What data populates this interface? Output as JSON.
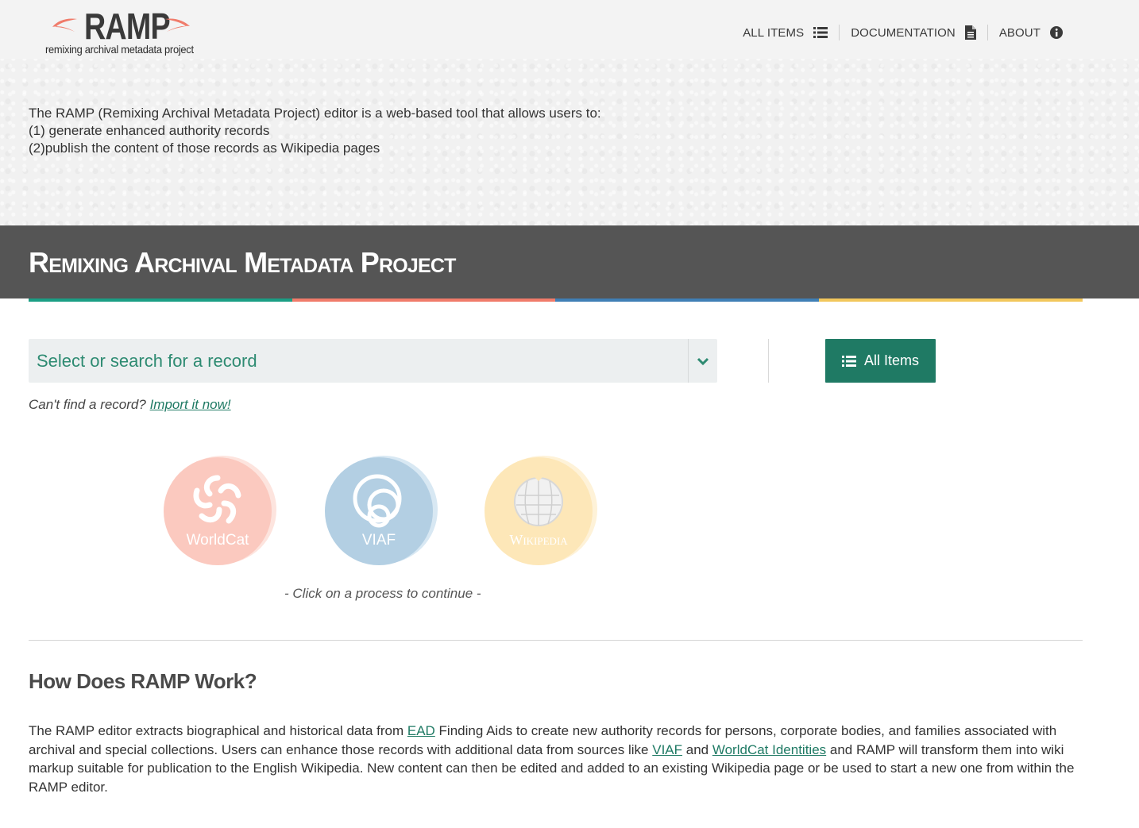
{
  "header": {
    "logo_word": "RAMP",
    "logo_sub": "remixing archival metadata project",
    "nav": [
      {
        "label": "ALL ITEMS",
        "icon": "list-icon"
      },
      {
        "label": "DOCUMENTATION",
        "icon": "document-icon"
      },
      {
        "label": "ABOUT",
        "icon": "info-icon"
      }
    ]
  },
  "intro": {
    "line1": "The RAMP (Remixing Archival Metadata Project) editor is a web-based tool that allows users to:",
    "line2": "(1) generate enhanced authority records",
    "line3": "(2)publish the content of those records as Wikipedia pages"
  },
  "band": {
    "title": "Remixing Archival Metadata Project",
    "stripe_colors": [
      "#1a9e84",
      "#f07b6a",
      "#3f7fb5",
      "#f2c75c"
    ]
  },
  "search": {
    "placeholder": "Select or search for a record",
    "all_items_label": "All Items"
  },
  "import": {
    "prefix": "Can't find a record?",
    "link": "Import it now!"
  },
  "processes": [
    {
      "label": "WorldCat",
      "color": "#fbc9bf",
      "shadow": "#fde4de",
      "icon": "worldcat-icon"
    },
    {
      "label": "VIAF",
      "color": "#b3cfe3",
      "shadow": "#d8e8f3",
      "icon": "viaf-icon"
    },
    {
      "label": "Wikipedia",
      "color": "#fde7b8",
      "shadow": "#fef2d8",
      "icon": "wikipedia-globe-icon"
    }
  ],
  "hint": "- Click on a process to continue -",
  "how": {
    "title": "How Does RAMP Work?",
    "t1": "The RAMP editor extracts biographical and historical data from ",
    "link_ead": "EAD",
    "t2": " Finding Aids to create new authority records for persons, corporate bodies, and families associated with archival and special collections. Users can enhance those records with additional data from sources like ",
    "link_viaf": "VIAF",
    "t3": " and ",
    "link_worldcat": "WorldCat Identities",
    "t4": " and RAMP will transform them into wiki markup suitable for publication to the English Wikipedia. New content can then be edited and added to an existing Wikipedia page or be used to start a new one from within the RAMP editor."
  }
}
